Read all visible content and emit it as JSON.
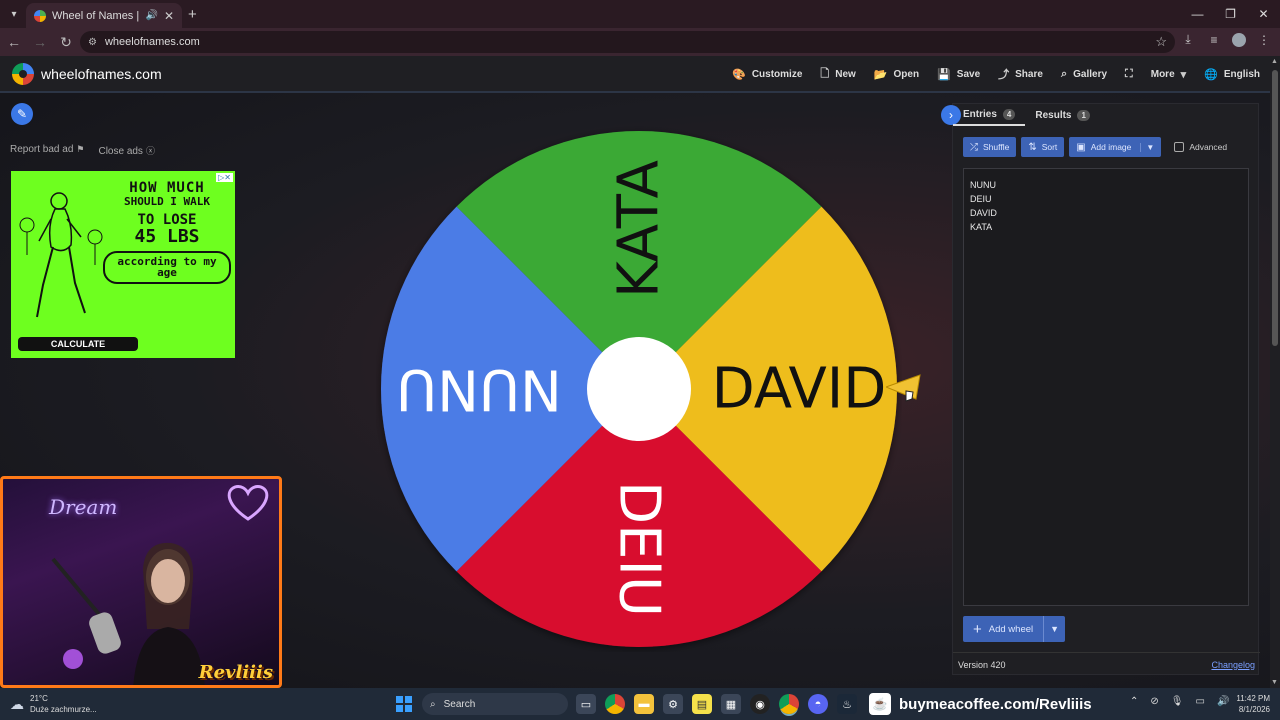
{
  "browser": {
    "tab_title": "Wheel of Names | Random",
    "url": "wheelofnames.com"
  },
  "site": {
    "name": "wheelofnames.com",
    "menu": [
      {
        "icon": "palette-icon",
        "glyph": "🎨",
        "label": "Customize"
      },
      {
        "icon": "file-icon",
        "glyph": "🗋",
        "label": "New"
      },
      {
        "icon": "folder-icon",
        "glyph": "📂",
        "label": "Open"
      },
      {
        "icon": "save-icon",
        "glyph": "💾",
        "label": "Save"
      },
      {
        "icon": "share-icon",
        "glyph": "⤴",
        "label": "Share"
      },
      {
        "icon": "search-icon",
        "glyph": "⌕",
        "label": "Gallery"
      },
      {
        "icon": "fullscreen-icon",
        "glyph": "⛶",
        "label": ""
      },
      {
        "icon": "chevron-down-icon",
        "glyph": "▾",
        "label": "More"
      },
      {
        "icon": "globe-icon",
        "glyph": "🌐",
        "label": "English"
      }
    ]
  },
  "ad": {
    "report_label": "Report bad ad",
    "close_label": "Close ads",
    "line1": "HOW MUCH",
    "line2": "SHOULD I WALK",
    "line3": "TO LOSE",
    "line4": "45 LBS",
    "line5": "according to my age",
    "cta": "CALCULATE"
  },
  "webcam": {
    "neon_sign": "Dream",
    "brand": "Revliiis"
  },
  "wheel": {
    "segments": [
      {
        "name": "KATA",
        "color": "#3aa934"
      },
      {
        "name": "DAVID",
        "color": "#eebd1e"
      },
      {
        "name": "DEIU",
        "color": "#d8102e"
      },
      {
        "name": "NUNU",
        "color": "#4b7ce6"
      }
    ]
  },
  "panel": {
    "tab_entries": "Entries",
    "entries_count": "4",
    "tab_results": "Results",
    "results_count": "1",
    "shuffle_label": "Shuffle",
    "sort_label": "Sort",
    "add_image_label": "Add image",
    "advanced_label": "Advanced",
    "entries": [
      "NUNU",
      "DEIU",
      "DAVID",
      "KATA"
    ],
    "add_wheel_label": "Add wheel",
    "version": "Version 420",
    "changelog": "Changelog"
  },
  "taskbar": {
    "temperature": "21°C",
    "weather": "Duże zachmurze...",
    "search": "Search",
    "bmc": "buymeacoffee.com/Revliiis",
    "time": "11:42 PM",
    "date": "8/1/2026"
  }
}
